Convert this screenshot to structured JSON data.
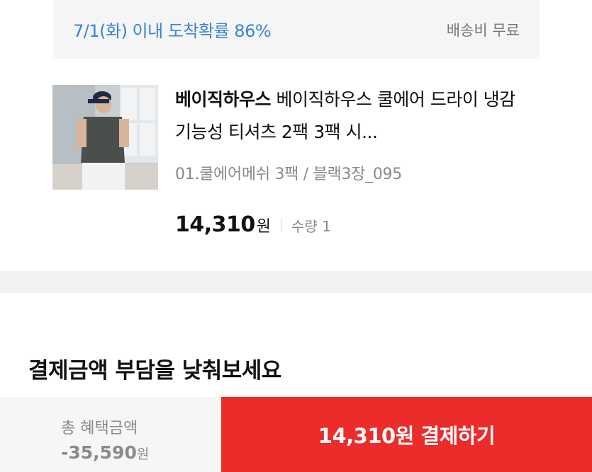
{
  "delivery": {
    "eta_text": "7/1(화) 이내 도착확률 86%",
    "shipping_fee": "배송비 무료"
  },
  "product": {
    "image_icon": "product-photo-man-in-tshirt",
    "brand": "베이직하우스",
    "name": "베이직하우스 쿨에어 드라이 냉감 기능성 티셔츠 2팩 3팩 시...",
    "option": "01.쿨에어메쉬 3팩 / 블랙3장_095",
    "price": "14,310",
    "price_unit": "원",
    "quantity": "수량 1"
  },
  "promo": {
    "heading": "결제금액 부담을 낮춰보세요"
  },
  "bottom_bar": {
    "benefit_label": "총 혜택금액",
    "benefit_amount": "-35,590",
    "benefit_unit": "원",
    "pay_button_label": "14,310원 결제하기"
  },
  "colors": {
    "accent_blue": "#3b82d6",
    "pay_red": "#ec2b2b"
  }
}
